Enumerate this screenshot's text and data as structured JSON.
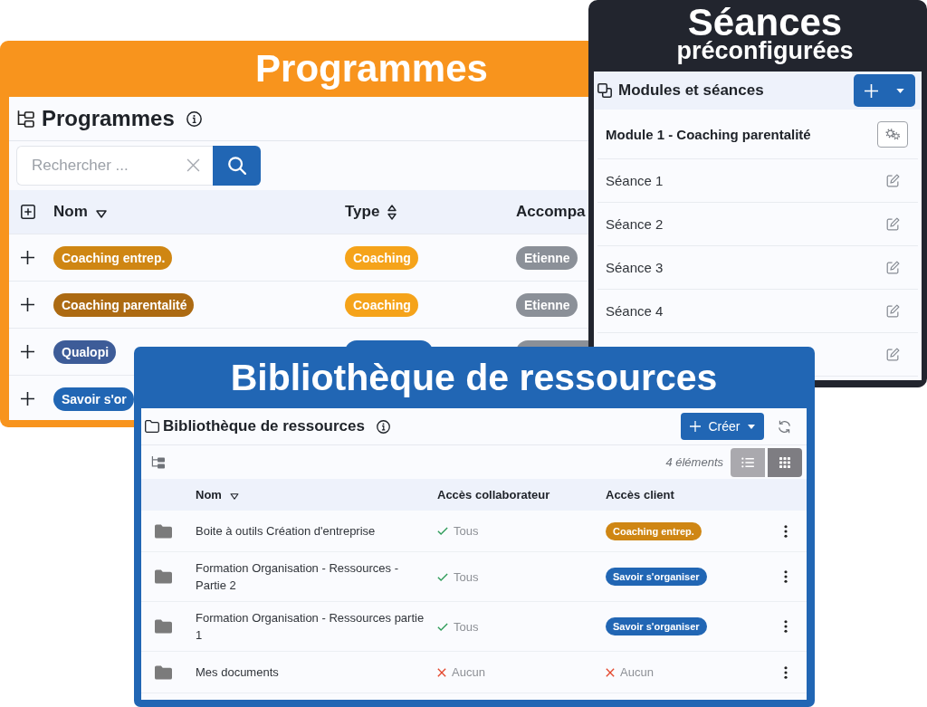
{
  "programmes": {
    "banner": "Programmes",
    "title": "Programmes",
    "search": {
      "placeholder": "Rechercher ..."
    },
    "table": {
      "columns": [
        {
          "label": "Nom",
          "sorted": true
        },
        {
          "label": "Type",
          "sorted": false
        },
        {
          "label": "Accompa"
        }
      ],
      "rows": [
        {
          "cells": [
            {
              "label": "Coaching entrep.",
              "color": "#cf8613"
            },
            {
              "label": "Coaching",
              "color": "#f5a31a"
            },
            {
              "label": "Etienne",
              "color": "#8b9098"
            }
          ]
        },
        {
          "cells": [
            {
              "label": "Coaching parentalité",
              "color": "#ac6a12"
            },
            {
              "label": "Coaching",
              "color": "#f5a31a"
            },
            {
              "label": "Etienne",
              "color": "#8b9098"
            }
          ]
        },
        {
          "cells": [
            {
              "label": "Qualopi",
              "color": "#3d5c98"
            },
            {
              "color": "#2166b4"
            },
            {
              "color": "#8b9098"
            }
          ]
        },
        {
          "cells": [
            {
              "label": "Savoir s'or",
              "color": "#2166b4"
            }
          ]
        }
      ]
    }
  },
  "sessions": {
    "banner": {
      "title": "Séances",
      "subtitle": "préconfigurées"
    },
    "title": "Modules et séances",
    "items": [
      {
        "kind": "module",
        "label": "Module 1 - Coaching parentalité"
      },
      {
        "kind": "session",
        "label": "Séance 1"
      },
      {
        "kind": "session",
        "label": "Séance 2"
      },
      {
        "kind": "session",
        "label": "Séance 3"
      },
      {
        "kind": "session",
        "label": "Séance 4"
      },
      {
        "kind": "session"
      }
    ]
  },
  "library": {
    "banner": "Bibliothèque de ressources",
    "title": "Bibliothèque de ressources",
    "create_button": "Créer",
    "count": "4 éléments",
    "views": [
      {
        "kind": "list",
        "selected": false
      },
      {
        "kind": "grid",
        "selected": true
      }
    ],
    "table": {
      "columns": [
        {
          "label": "Nom",
          "sorted": true
        },
        {
          "label": "Accès collaborateur"
        },
        {
          "label": "Accès client"
        }
      ],
      "rows": [
        {
          "name": "Boite à outils Création d'entreprise",
          "collaborator": {
            "kind": "granted",
            "label": "Tous"
          },
          "client": {
            "kind": "tag",
            "label": "Coaching entrep.",
            "color": "#cf8613"
          }
        },
        {
          "name": "Formation Organisation - Ressources - Partie 2",
          "collaborator": {
            "kind": "granted",
            "label": "Tous"
          },
          "client": {
            "kind": "tag",
            "label": "Savoir s'organiser",
            "color": "#2166b4"
          }
        },
        {
          "name": "Formation Organisation - Ressources partie 1",
          "collaborator": {
            "kind": "granted",
            "label": "Tous"
          },
          "client": {
            "kind": "tag",
            "label": "Savoir s'organiser",
            "color": "#2166b4"
          }
        },
        {
          "name": "Mes documents",
          "collaborator": {
            "kind": "denied",
            "label": "Aucun"
          },
          "client": {
            "kind": "denied",
            "label": "Aucun"
          }
        }
      ]
    }
  }
}
